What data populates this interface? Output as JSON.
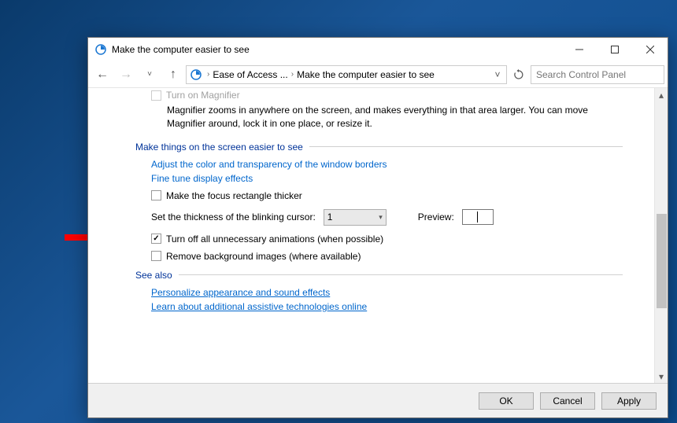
{
  "window": {
    "title": "Make the computer easier to see"
  },
  "breadcrumb": {
    "item1": "Ease of Access ...",
    "item2": "Make the computer easier to see"
  },
  "search": {
    "placeholder": "Search Control Panel"
  },
  "content": {
    "magnifier_disabled": "Turn on Magnifier",
    "magnifier_desc": "Magnifier zooms in anywhere on the screen, and makes everything in that area larger. You can move Magnifier around, lock it in one place, or resize it.",
    "section_make_things": "Make things on the screen easier to see",
    "link_colors": "Adjust the color and transparency of the window borders",
    "link_display": "Fine tune display effects",
    "chk_focus_rect": "Make the focus rectangle thicker",
    "cursor_label": "Set the thickness of the blinking cursor:",
    "cursor_value": "1",
    "preview_label": "Preview:",
    "chk_animations": "Turn off all unnecessary animations (when possible)",
    "chk_background": "Remove background images (where available)",
    "section_see_also": "See also",
    "link_personalize": "Personalize appearance and sound effects",
    "link_assistive": "Learn about additional assistive technologies online"
  },
  "footer": {
    "ok": "OK",
    "cancel": "Cancel",
    "apply": "Apply"
  }
}
